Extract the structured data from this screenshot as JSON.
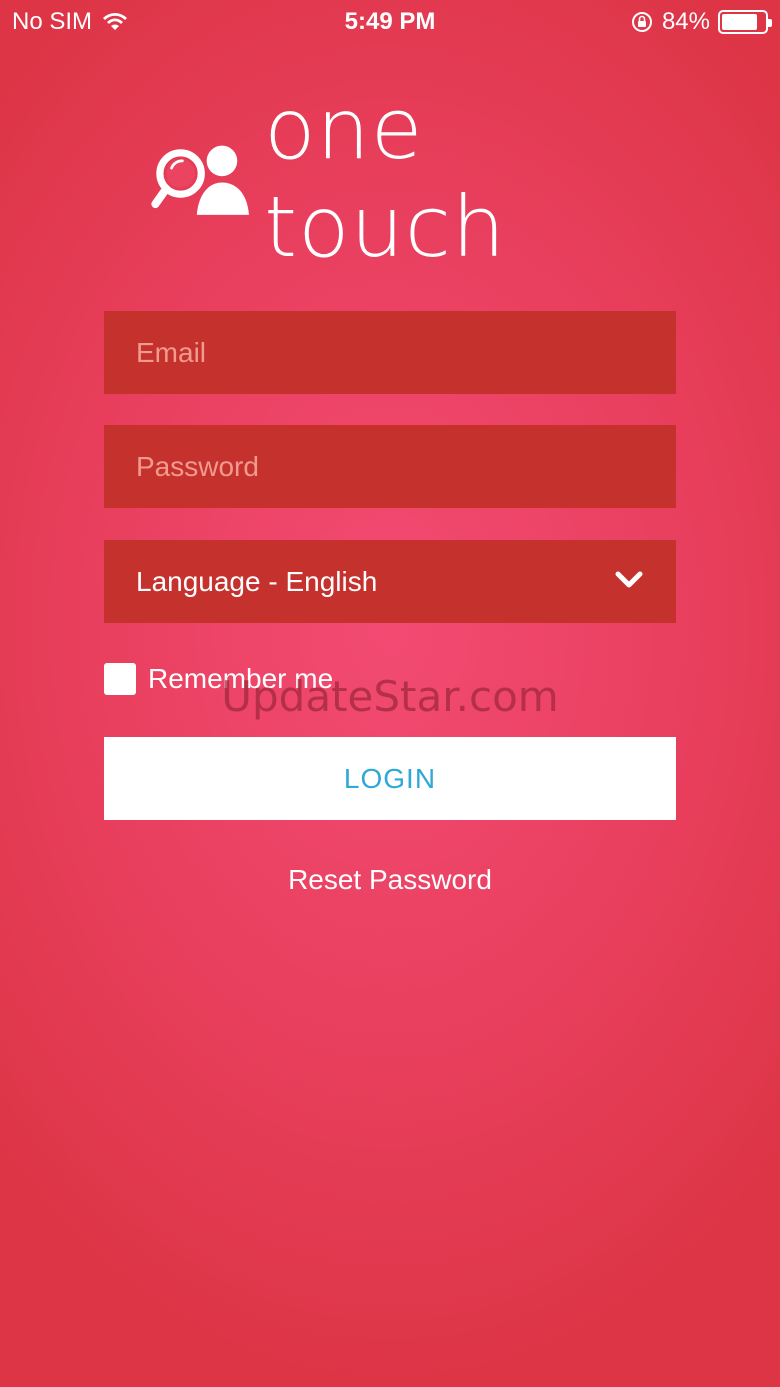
{
  "status_bar": {
    "carrier": "No SIM",
    "time": "5:49 PM",
    "battery_percent": "84%",
    "battery_level": 0.84,
    "icons": [
      "wifi-icon",
      "rotation-lock-icon",
      "battery-icon"
    ]
  },
  "logo": {
    "text": "one touch",
    "icon": "user-search-icon"
  },
  "form": {
    "email_placeholder": "Email",
    "password_placeholder": "Password",
    "language_label": "Language - English",
    "remember_label": "Remember me",
    "login_label": "LOGIN",
    "reset_label": "Reset Password"
  },
  "watermark": "UpdateStar.com",
  "colors": {
    "background": "#e93f5e",
    "field": "#c5322e",
    "button_text": "#2fa8d8"
  }
}
